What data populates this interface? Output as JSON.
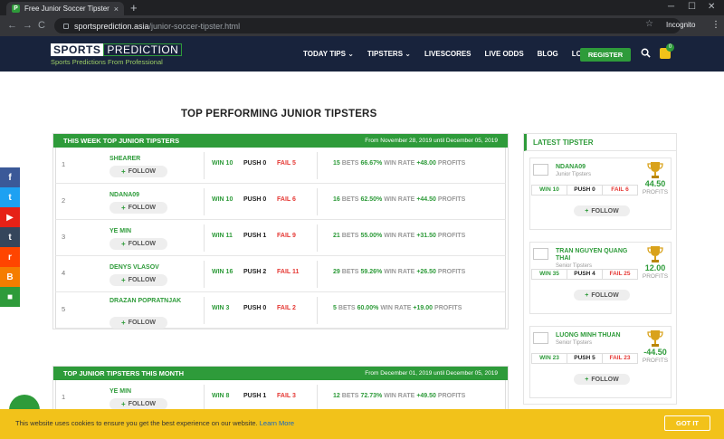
{
  "browser": {
    "tab_title": "Free Junior Soccer Tipsters Perfo",
    "tab_close": "×",
    "newtab": "+",
    "win_min": "─",
    "win_max": "☐",
    "win_close": "✕",
    "url_host": "sportsprediction.asia",
    "url_path": "/junior-soccer-tipster.html",
    "incognito_label": "Incognito",
    "back": "←",
    "forward": "→",
    "reload": "C",
    "menu": "⋮",
    "star": "☆"
  },
  "site": {
    "logo_sports": "SPORTS",
    "logo_prediction": "PREDICTION",
    "logo_tagline": "Sports Predictions From Professional",
    "nav": [
      "TODAY TIPS ⌄",
      "TIPSTERS ⌄",
      "LIVESCORES",
      "LIVE ODDS",
      "BLOG",
      "LOGIN"
    ],
    "register_label": "REGISTER",
    "cart_count": "0"
  },
  "page": {
    "title": "TOP PERFORMING JUNIOR TIPSTERS"
  },
  "week_panel": {
    "title": "THIS WEEK TOP JUNIOR TIPSTERS",
    "range": "From November 28, 2019 until December 05, 2019",
    "follow_label": "FOLLOW",
    "rows": [
      {
        "rank": "1",
        "name": "SHEARER",
        "win": "WIN 10",
        "push": "PUSH 0",
        "fail": "FAIL 5",
        "bets": "15",
        "bets_label": "BETS",
        "rate": "66.67%",
        "rate_label": "WIN RATE",
        "profit": "+48.00",
        "profit_label": "PROFITS"
      },
      {
        "rank": "2",
        "name": "NDANA09",
        "win": "WIN 10",
        "push": "PUSH 0",
        "fail": "FAIL 6",
        "bets": "16",
        "bets_label": "BETS",
        "rate": "62.50%",
        "rate_label": "WIN RATE",
        "profit": "+44.50",
        "profit_label": "PROFITS"
      },
      {
        "rank": "3",
        "name": "YE MIN",
        "win": "WIN 11",
        "push": "PUSH 1",
        "fail": "FAIL 9",
        "bets": "21",
        "bets_label": "BETS",
        "rate": "55.00%",
        "rate_label": "WIN RATE",
        "profit": "+31.50",
        "profit_label": "PROFITS"
      },
      {
        "rank": "4",
        "name": "DENYS VLASOV",
        "win": "WIN 16",
        "push": "PUSH 2",
        "fail": "FAIL 11",
        "bets": "29",
        "bets_label": "BETS",
        "rate": "59.26%",
        "rate_label": "WIN RATE",
        "profit": "+26.50",
        "profit_label": "PROFITS"
      },
      {
        "rank": "5",
        "name": "DRAZAN POPRATNJAK",
        "win": "WIN 3",
        "push": "PUSH 0",
        "fail": "FAIL 2",
        "bets": "5",
        "bets_label": "BETS",
        "rate": "60.00%",
        "rate_label": "WIN RATE",
        "profit": "+19.00",
        "profit_label": "PROFITS"
      }
    ]
  },
  "month_panel": {
    "title": "TOP JUNIOR TIPSTERS THIS MONTH",
    "range": "From December 01, 2019 until December 05, 2019",
    "rows": [
      {
        "rank": "1",
        "name": "YE MIN",
        "win": "WIN 8",
        "push": "PUSH 1",
        "fail": "FAIL 3",
        "bets": "12",
        "bets_label": "BETS",
        "rate": "72.73%",
        "rate_label": "WIN RATE",
        "profit": "+49.50",
        "profit_label": "PROFITS"
      }
    ]
  },
  "social": {
    "facebook": "f",
    "twitter": "t",
    "youtube": "▶",
    "tumblr": "t",
    "reddit": "r",
    "blogger": "B",
    "video": "■"
  },
  "sidebar": {
    "title": "LATEST TIPSTER",
    "follow_label": "FOLLOW",
    "profits_label": "PROFITS",
    "cards": [
      {
        "name": "NDANA09",
        "level": "Junior Tipsters",
        "profit": "44.50",
        "win": "WIN 10",
        "push": "PUSH 0",
        "fail": "FAIL 6"
      },
      {
        "name": "TRAN NGUYEN QUANG THAI",
        "level": "Senior Tipsters",
        "profit": "12.00",
        "win": "WIN 35",
        "push": "PUSH 4",
        "fail": "FAIL 25"
      },
      {
        "name": "LUONG MINH THUAN",
        "level": "Senior Tipsters",
        "profit": "-44.50",
        "win": "WIN 23",
        "push": "PUSH 5",
        "fail": "FAIL 23"
      }
    ]
  },
  "cookie": {
    "text": "This website uses cookies to ensure you get the best experience on our website.",
    "learn_more": "Learn More",
    "button": "GOT IT"
  },
  "colors": {
    "brand_green": "#2e9b3a",
    "header_navy": "#18233c",
    "fail_red": "#e53935",
    "cookie_yellow": "#f2c21a"
  }
}
